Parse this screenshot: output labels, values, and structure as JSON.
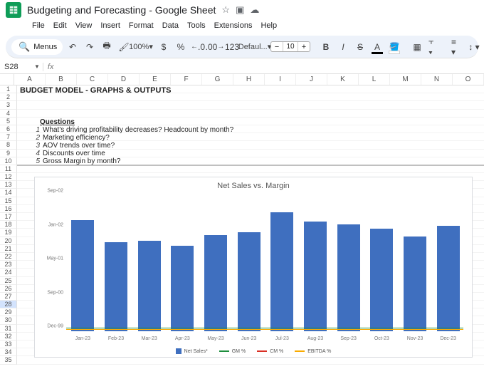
{
  "doc": {
    "title": "Budgeting and Forecasting - Google Sheet"
  },
  "menus": [
    "File",
    "Edit",
    "View",
    "Insert",
    "Format",
    "Data",
    "Tools",
    "Extensions",
    "Help"
  ],
  "toolbar": {
    "menus_label": "Menus",
    "zoom": "100%",
    "currency": "$",
    "percent": "%",
    "dec_dec": ".0",
    "inc_dec": ".00",
    "numfmt": "123",
    "font": "Defaul...",
    "font_size": "10"
  },
  "namebox": "S28",
  "columns": [
    "A",
    "B",
    "C",
    "D",
    "E",
    "F",
    "G",
    "H",
    "I",
    "J",
    "K",
    "L",
    "M",
    "N",
    "O"
  ],
  "row_count": 35,
  "active_row": 28,
  "content": {
    "heading": "BUDGET MODEL - GRAPHS & OUTPUTS",
    "questions_hdr": "Questions",
    "questions": [
      {
        "n": "1",
        "t": "What's driving profitability decreases? Headcount by month?"
      },
      {
        "n": "2",
        "t": "Marketing efficiency?"
      },
      {
        "n": "3",
        "t": "AOV trends over time?"
      },
      {
        "n": "4",
        "t": "Discounts over time"
      },
      {
        "n": "5",
        "t": "Gross Margin by month?"
      }
    ]
  },
  "chart_data": {
    "type": "bar",
    "title": "Net Sales vs. Margin",
    "categories": [
      "Jan-23",
      "Feb-23",
      "Mar-23",
      "Apr-23",
      "May-23",
      "Jun-23",
      "Jul-23",
      "Aug-23",
      "Sep-23",
      "Oct-23",
      "Nov-23",
      "Dec-23"
    ],
    "series": [
      {
        "name": "Net Sales*",
        "type": "bar",
        "color": "#3f6fbf",
        "values": [
          82,
          66,
          67,
          63,
          71,
          73,
          88,
          81,
          79,
          76,
          70,
          78
        ]
      },
      {
        "name": "GM %",
        "type": "line",
        "color": "#1e8e3e",
        "values": [
          2,
          2,
          2,
          2,
          2,
          2,
          2,
          2,
          2,
          2,
          2,
          2
        ]
      },
      {
        "name": "CM %",
        "type": "line",
        "color": "#d93025",
        "values": [
          1,
          1,
          1,
          1,
          1,
          1,
          1,
          1,
          1,
          1,
          1,
          1
        ]
      },
      {
        "name": "EBITDA %",
        "type": "line",
        "color": "#f9ab00",
        "values": [
          1,
          1,
          1,
          1,
          1,
          1,
          1,
          1,
          1,
          1,
          1,
          1
        ]
      }
    ],
    "yticks": [
      "Dec-99",
      "Sep-00",
      "May-01",
      "Jan-02",
      "Sep-02"
    ],
    "ylim": [
      0,
      100
    ]
  }
}
